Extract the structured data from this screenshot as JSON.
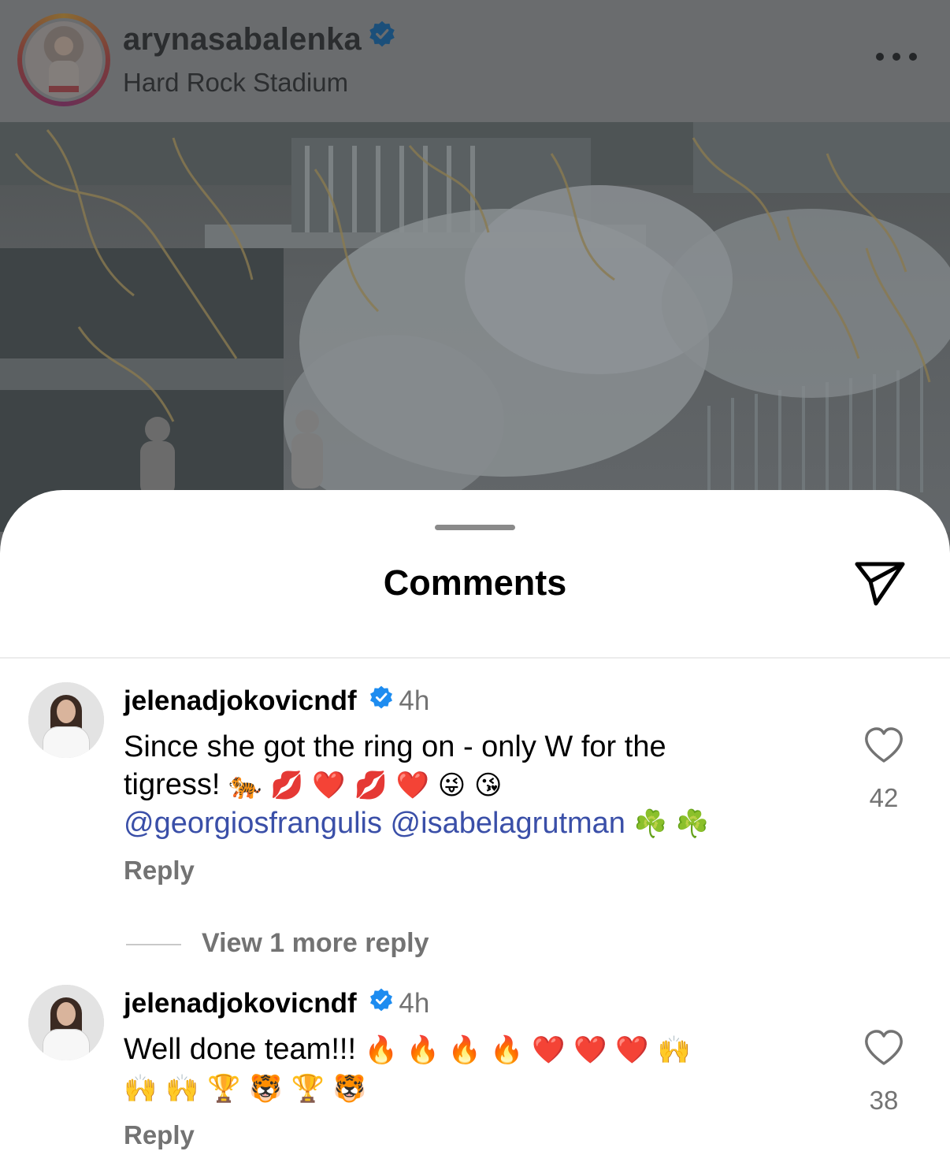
{
  "post": {
    "username": "arynasabalenka",
    "location": "Hard Rock Stadium"
  },
  "sheet": {
    "title": "Comments"
  },
  "comments": [
    {
      "username": "jelenadjokovicndf",
      "time": "4h",
      "text_line1": "Since she got the ring on - only W for the",
      "text_line2": "tigress!",
      "emojis_line2": "🐅 💋 ❤️ 💋 ❤️  😜 😘",
      "mention1": "@georgiosfrangulis",
      "mention2": "@isabelagrutman",
      "emojis_line3": "☘️ ☘️",
      "reply_label": "Reply",
      "likes": "42",
      "view_replies": "View 1 more reply"
    },
    {
      "username": "jelenadjokovicndf",
      "time": "4h",
      "text_line1": "Well done team!!!",
      "emojis_line1": "🔥 🔥 🔥 🔥 ❤️ ❤️ ❤️ 🙌",
      "emojis_line2": "🙌 🙌  🏆 🐯 🏆 🐯",
      "reply_label": "Reply",
      "likes": "38"
    }
  ],
  "colors": {
    "mention": "#3a4fa8",
    "verified": "#1d8cf0",
    "secondary_text": "#737373"
  }
}
